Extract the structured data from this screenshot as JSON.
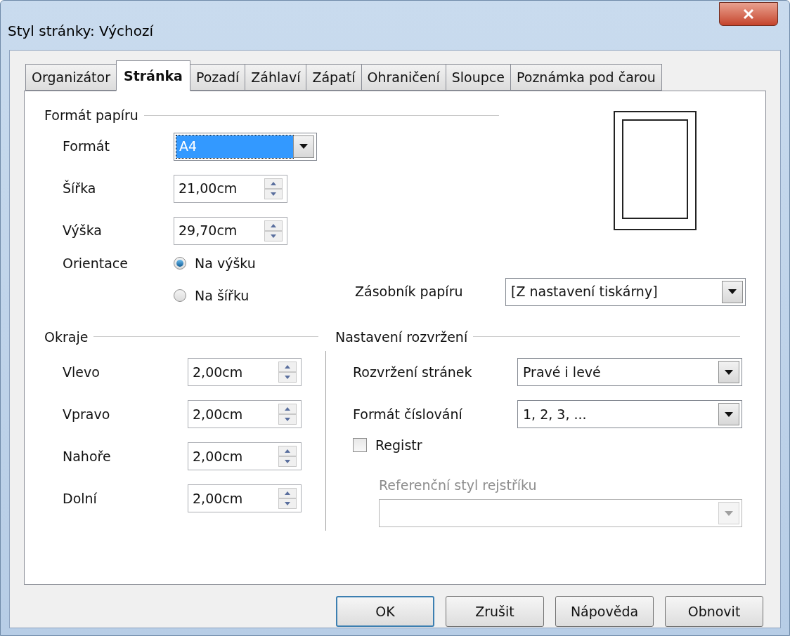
{
  "window": {
    "title": "Styl stránky: Výchozí"
  },
  "tabs": [
    {
      "label": "Organizátor",
      "selected": false
    },
    {
      "label": "Stránka",
      "selected": true
    },
    {
      "label": "Pozadí",
      "selected": false
    },
    {
      "label": "Záhlaví",
      "selected": false
    },
    {
      "label": "Zápatí",
      "selected": false
    },
    {
      "label": "Ohraničení",
      "selected": false
    },
    {
      "label": "Sloupce",
      "selected": false
    },
    {
      "label": "Poznámka pod čarou",
      "selected": false
    }
  ],
  "paper_format": {
    "heading": "Formát papíru",
    "format": {
      "label": "Formát",
      "value": "A4",
      "focused": true
    },
    "width": {
      "label": "Šířka",
      "value": "21,00cm"
    },
    "height": {
      "label": "Výška",
      "value": "29,70cm"
    },
    "orientation": {
      "label": "Orientace",
      "options": [
        {
          "label": "Na výšku",
          "selected": true
        },
        {
          "label": "Na šířku",
          "selected": false
        }
      ]
    },
    "paper_tray": {
      "label": "Zásobník papíru",
      "value": "[Z nastavení tiskárny]"
    }
  },
  "margins": {
    "heading": "Okraje",
    "fields": [
      {
        "label": "Vlevo",
        "value": "2,00cm"
      },
      {
        "label": "Vpravo",
        "value": "2,00cm"
      },
      {
        "label": "Nahoře",
        "value": "2,00cm"
      },
      {
        "label": "Dolní",
        "value": "2,00cm"
      }
    ]
  },
  "layout": {
    "heading": "Nastavení rozvržení",
    "page_layout": {
      "label": "Rozvržení stránek",
      "value": "Pravé i levé"
    },
    "numbering": {
      "label": "Formát číslování",
      "value": "1, 2, 3, ..."
    },
    "register": {
      "label": "Registr",
      "checked": false
    },
    "reference_style": {
      "label": "Referenční styl rejstříku",
      "disabled": true
    }
  },
  "buttons": [
    {
      "label": "OK",
      "default": true
    },
    {
      "label": "Zrušit",
      "default": false
    },
    {
      "label": "Nápověda",
      "default": false
    },
    {
      "label": "Obnovit",
      "default": false
    }
  ]
}
